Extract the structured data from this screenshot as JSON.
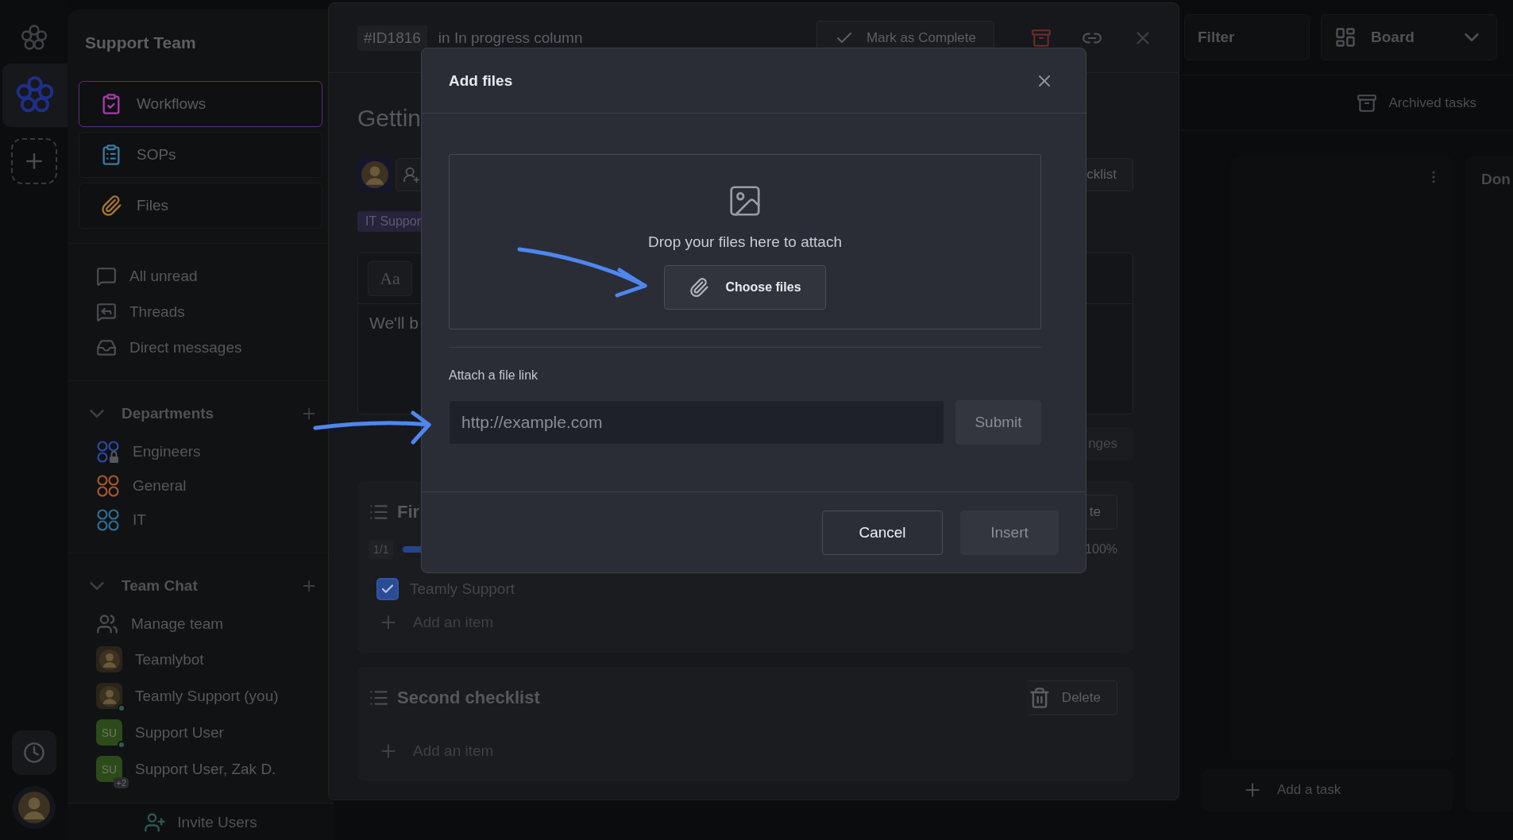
{
  "rail": {
    "workspaces": [
      {
        "selected": true
      }
    ]
  },
  "sidebar": {
    "title": "Support Team",
    "nav": [
      {
        "label": "Workflows",
        "selected": true,
        "color": "#a63aa8",
        "kind": "workflows"
      },
      {
        "label": "SOPs",
        "selected": false,
        "color": "#3b7aa3",
        "kind": "sops"
      },
      {
        "label": "Files",
        "selected": false,
        "color": "#a8772c",
        "kind": "files"
      }
    ],
    "links": [
      {
        "label": "All unread",
        "kind": "unread"
      },
      {
        "label": "Threads",
        "kind": "threads"
      },
      {
        "label": "Direct messages",
        "kind": "direct"
      }
    ],
    "sections": [
      {
        "title": "Departments",
        "expanded": true,
        "items": [
          {
            "label": "Engineers",
            "kind": "channel",
            "color": "#2d49a0",
            "locked": true
          },
          {
            "label": "General",
            "kind": "channel",
            "color": "#a3562c",
            "locked": false
          },
          {
            "label": "IT",
            "kind": "channel",
            "color": "#2f6c93",
            "locked": false
          }
        ]
      },
      {
        "title": "Team Chat",
        "expanded": true,
        "items": [
          {
            "label": "Manage team",
            "kind": "team"
          },
          {
            "label": "Teamlybot",
            "kind": "picture",
            "online": false
          },
          {
            "label": "Teamly Support (you)",
            "kind": "picture",
            "online": true
          },
          {
            "label": "Support User",
            "kind": "initials",
            "initials": "SU",
            "online": true
          },
          {
            "label": "Support User, Zak D.",
            "kind": "initials",
            "initials": "SU",
            "badge": "+2",
            "online": false
          }
        ]
      }
    ],
    "invite": "Invite Users"
  },
  "board": {
    "filter": "Filter",
    "view": "Board",
    "archived": "Archived tasks",
    "next_column": "Don",
    "add_task": "Add a task"
  },
  "task": {
    "id": "#ID1816",
    "location": "in In progress column",
    "complete": "Mark as Complete",
    "title": "Gettin",
    "tag": "IT Suppor",
    "editor_tool": "Aa",
    "body": "We'll b",
    "save_partial": "nges",
    "checklist_partial": "cklist",
    "checklists": [
      {
        "title": "Fir",
        "action": "te",
        "count": "1/1",
        "level": 1,
        "percent": "100%",
        "items": [
          {
            "label": "Teamly Support",
            "checked": true
          }
        ],
        "add": "Add an item"
      },
      {
        "title": "Second checklist",
        "action": "Delete",
        "add": "Add an item"
      }
    ]
  },
  "modal": {
    "title": "Add files",
    "drop_text": "Drop your files here to attach",
    "choose": "Choose files",
    "link_label": "Attach a file link",
    "link_placeholder": "http://example.com",
    "submit": {
      "label": "Submit",
      "disabled": true
    },
    "cancel": {
      "label": "Cancel",
      "disabled": false
    },
    "insert": {
      "label": "Insert",
      "disabled": true
    }
  }
}
